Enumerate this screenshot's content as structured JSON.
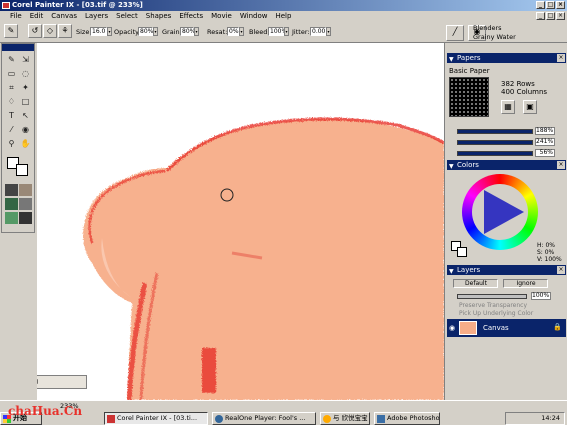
{
  "window": {
    "title": "Corel Painter IX - [03.tif @ 233%]"
  },
  "menu": [
    "File",
    "Edit",
    "Canvas",
    "Layers",
    "Select",
    "Shapes",
    "Effects",
    "Movie",
    "Window",
    "Help"
  ],
  "property_bar": {
    "size_label": "Size:",
    "size_value": "16.0",
    "opacity_label": "Opacity:",
    "opacity_value": "80%",
    "grain_label": "Grain:",
    "grain_value": "80%",
    "resat_label": "Resat:",
    "resat_value": "0%",
    "bleed_label": "Bleed:",
    "bleed_value": "100%",
    "jitter_label": "Jitter:",
    "jitter_value": "0.00"
  },
  "brush_selector": {
    "category": "Blenders",
    "variant": "Grainy Water"
  },
  "papers_panel": {
    "title": "Papers",
    "paper_name": "Basic Paper",
    "rows": "382 Rows",
    "columns": "400 Columns",
    "scale_value": "188%",
    "contrast_value": "241%",
    "brightness_value": "56%"
  },
  "colors_panel": {
    "title": "Colors",
    "h": "H: 0%",
    "s": "S: 0%",
    "v": "V: 100%"
  },
  "layers_panel": {
    "title": "Layers",
    "composite_method": "Default",
    "composite_depth": "Ignore",
    "opacity_value": "100%",
    "preserve_transparency": "Preserve Transparency",
    "pick_up_underlying": "Pick Up Underlying Color",
    "layer_name": "Canvas"
  },
  "status": {
    "zoom": "233%"
  },
  "ime": {
    "label": "中"
  },
  "taskbar": {
    "start": "开始",
    "tasks": [
      "Corel Painter IX - [03.ti...",
      "RealOne Player: Fool's ...",
      "与 欣悦宝宝 聊天中",
      "Adobe Photoshop"
    ],
    "clock": "14:24"
  },
  "watermark": "chaHua.Cn",
  "colors": {
    "accent": "#0a246a",
    "paint": "#f7ad88",
    "stroke": "#e8302a",
    "face": "#d4d0c8"
  }
}
